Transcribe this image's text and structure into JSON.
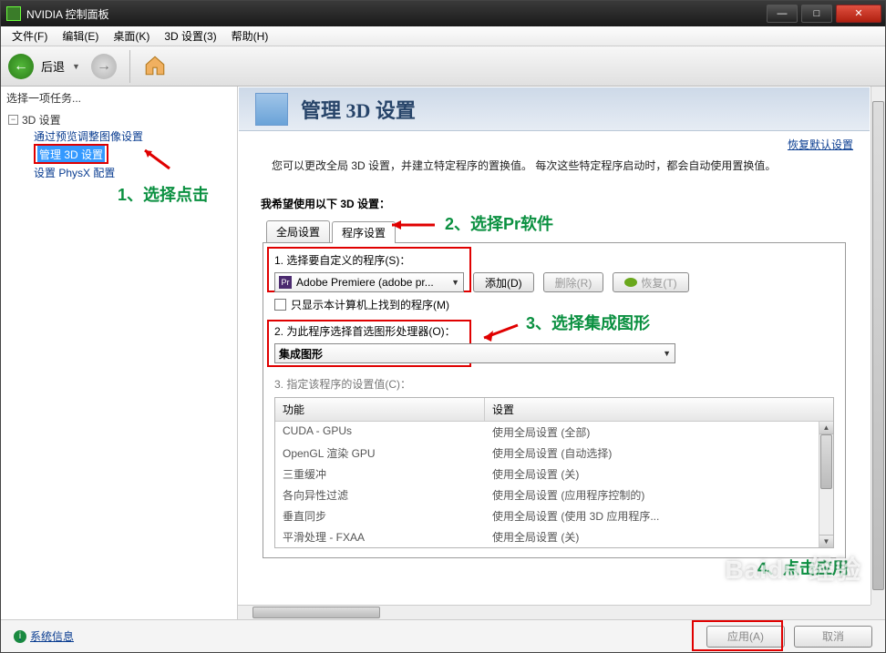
{
  "window_title": "NVIDIA 控制面板",
  "menu": {
    "file": "文件(F)",
    "edit": "编辑(E)",
    "desktop": "桌面(K)",
    "settings3d": "3D 设置(3)",
    "help": "帮助(H)"
  },
  "toolbar": {
    "back": "后退",
    "back_arrow": "←",
    "fwd_arrow": "→"
  },
  "left": {
    "task_header": "选择一项任务...",
    "root": "3D 设置",
    "item_preview": "通过预览调整图像设置",
    "item_manage": "管理 3D 设置",
    "item_physx": "设置 PhysX 配置"
  },
  "annotations": {
    "a1": "1、选择点击",
    "a2": "2、选择Pr软件",
    "a3": "3、选择集成图形",
    "a4": "4、点击应用"
  },
  "page": {
    "title": "管理 3D 设置",
    "restore": "恢复默认设置",
    "desc": "您可以更改全局 3D 设置，并建立特定程序的置换值。 每次这些特定程序启动时，都会自动使用置换值。",
    "section": "我希望使用以下 3D 设置：",
    "tab_global": "全局设置",
    "tab_program": "程序设置",
    "step1": "1. 选择要自定义的程序(S)：",
    "program": "Adobe Premiere (adobe pr...",
    "add": "添加(D)",
    "remove": "删除(R)",
    "restore_btn": "恢复(T)",
    "only_found": "只显示本计算机上找到的程序(M)",
    "step2": "2. 为此程序选择首选图形处理器(O)：",
    "gpu": "集成图形",
    "step3": "3. 指定该程序的设置值(C)：",
    "col_feature": "功能",
    "col_setting": "设置",
    "rows": [
      {
        "f": "CUDA - GPUs",
        "s": "使用全局设置 (全部)"
      },
      {
        "f": "OpenGL 渲染 GPU",
        "s": "使用全局设置 (自动选择)"
      },
      {
        "f": "三重缓冲",
        "s": "使用全局设置 (关)"
      },
      {
        "f": "各向异性过滤",
        "s": "使用全局设置 (应用程序控制的)"
      },
      {
        "f": "垂直同步",
        "s": "使用全局设置 (使用 3D 应用程序..."
      },
      {
        "f": "平滑处理 - FXAA",
        "s": "使用全局设置 (关)"
      }
    ]
  },
  "footer": {
    "sysinfo": "系统信息",
    "apply": "应用(A)",
    "cancel": "取消"
  },
  "watermark": "Baidu 经验"
}
